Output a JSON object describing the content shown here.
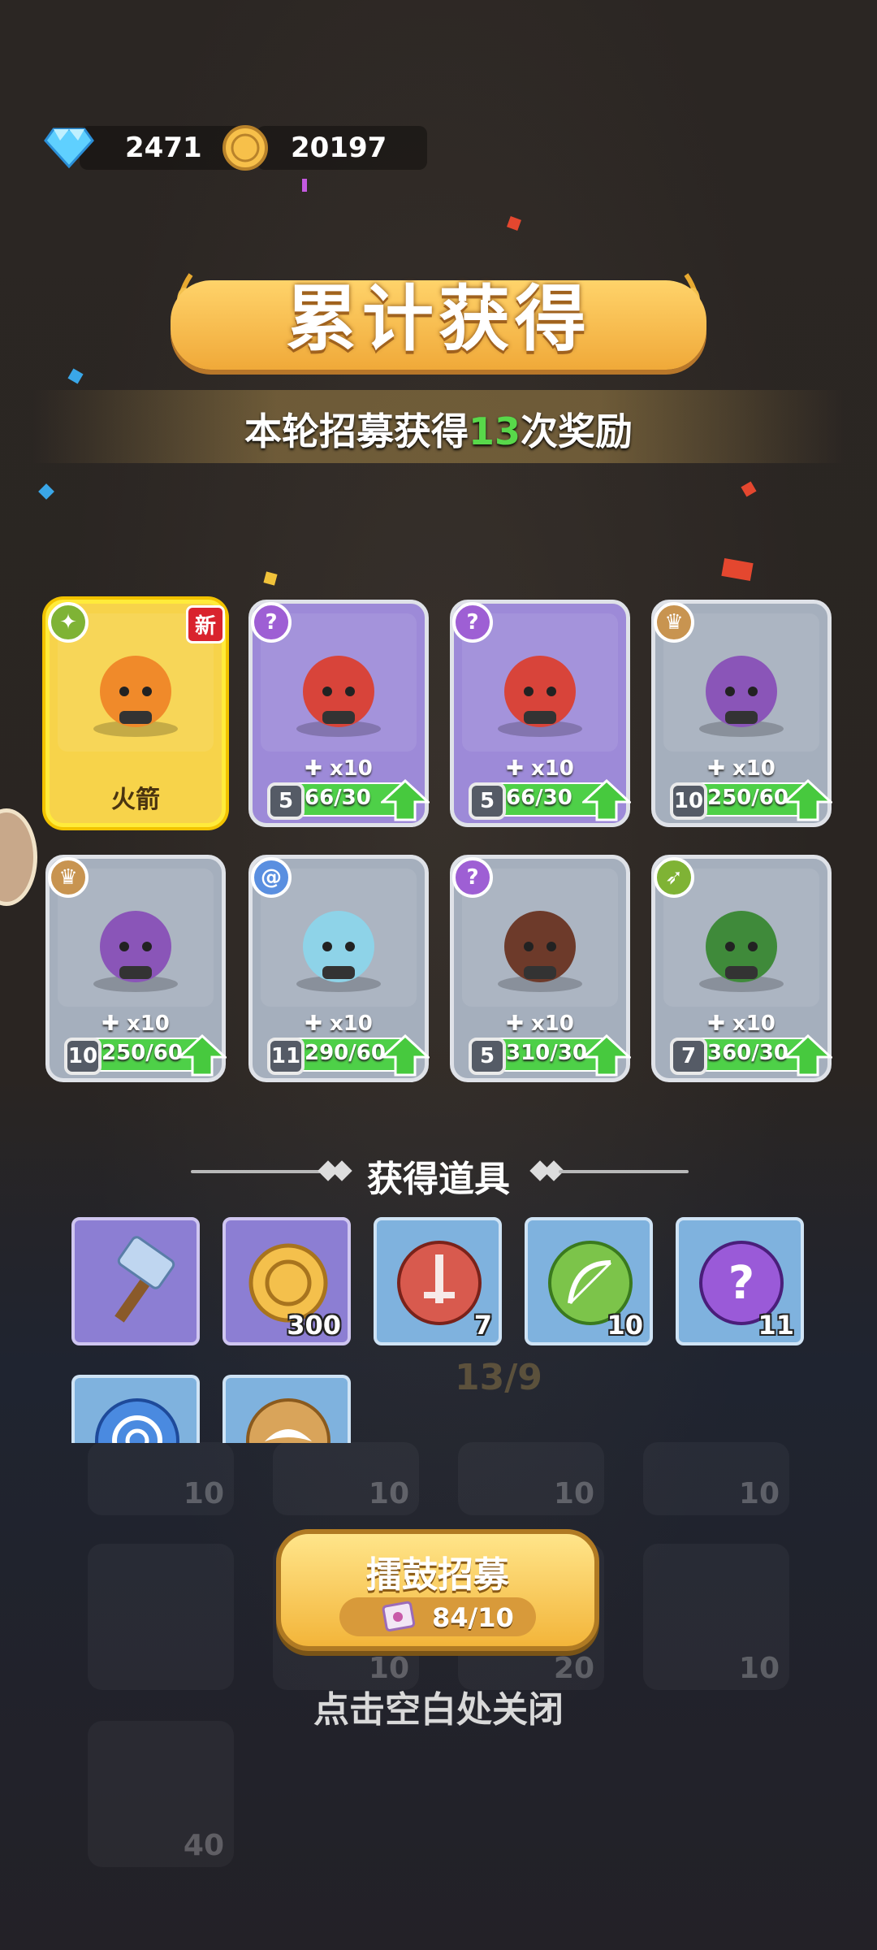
{
  "currency": {
    "diamonds": "2471",
    "coins": "20197"
  },
  "title": "累计获得",
  "subtitle": {
    "prefix": "本轮招募获得",
    "count": "13",
    "suffix": "次奖励"
  },
  "heroes": [
    {
      "name": "火箭",
      "new_label": "新",
      "frame": "gold",
      "class_icon": "star-class-icon"
    },
    {
      "fragments": "x10",
      "level": "5",
      "progress": "66/30",
      "progress_fraction": 1.0,
      "frame": "purple",
      "class_icon": "mystic-class-icon"
    },
    {
      "fragments": "x10",
      "level": "5",
      "progress": "66/30",
      "progress_fraction": 1.0,
      "frame": "purple",
      "class_icon": "mystic-class-icon"
    },
    {
      "fragments": "x10",
      "level": "10",
      "progress": "250/60",
      "progress_fraction": 1.0,
      "frame": "grey",
      "class_icon": "holy-class-icon"
    },
    {
      "fragments": "x10",
      "level": "10",
      "progress": "250/60",
      "progress_fraction": 1.0,
      "frame": "grey",
      "class_icon": "holy-class-icon"
    },
    {
      "fragments": "x10",
      "level": "11",
      "progress": "290/60",
      "progress_fraction": 1.0,
      "frame": "grey",
      "class_icon": "swirl-class-icon"
    },
    {
      "fragments": "x10",
      "level": "5",
      "progress": "310/30",
      "progress_fraction": 1.0,
      "frame": "grey",
      "class_icon": "mystic-class-icon"
    },
    {
      "fragments": "x10",
      "level": "7",
      "progress": "360/30",
      "progress_fraction": 1.0,
      "frame": "grey",
      "class_icon": "archer-class-icon"
    }
  ],
  "items_title": "获得道具",
  "items": [
    {
      "icon": "hammer-icon",
      "count": ""
    },
    {
      "icon": "gold-coin-icon",
      "count": "300"
    },
    {
      "icon": "sword-orb-icon",
      "count": "7"
    },
    {
      "icon": "bow-orb-icon",
      "count": "10"
    },
    {
      "icon": "mystic-orb-icon",
      "count": "11"
    },
    {
      "icon": "swirl-orb-icon",
      "count": ""
    },
    {
      "icon": "holy-orb-icon",
      "count": ""
    }
  ],
  "background": {
    "recruit_count": "13/9",
    "ghost_counts": [
      "10",
      "10",
      "10",
      "10",
      "10",
      "20",
      "10",
      "40"
    ]
  },
  "recruit_button": {
    "label": "擂鼓招募",
    "cost": "84/10"
  },
  "close_hint": "点击空白处关闭",
  "colors": {
    "accent_gold": "#f3b53a",
    "progress_green": "#4ed048",
    "highlight_green": "#58d84a",
    "new_red": "#d9232d"
  }
}
